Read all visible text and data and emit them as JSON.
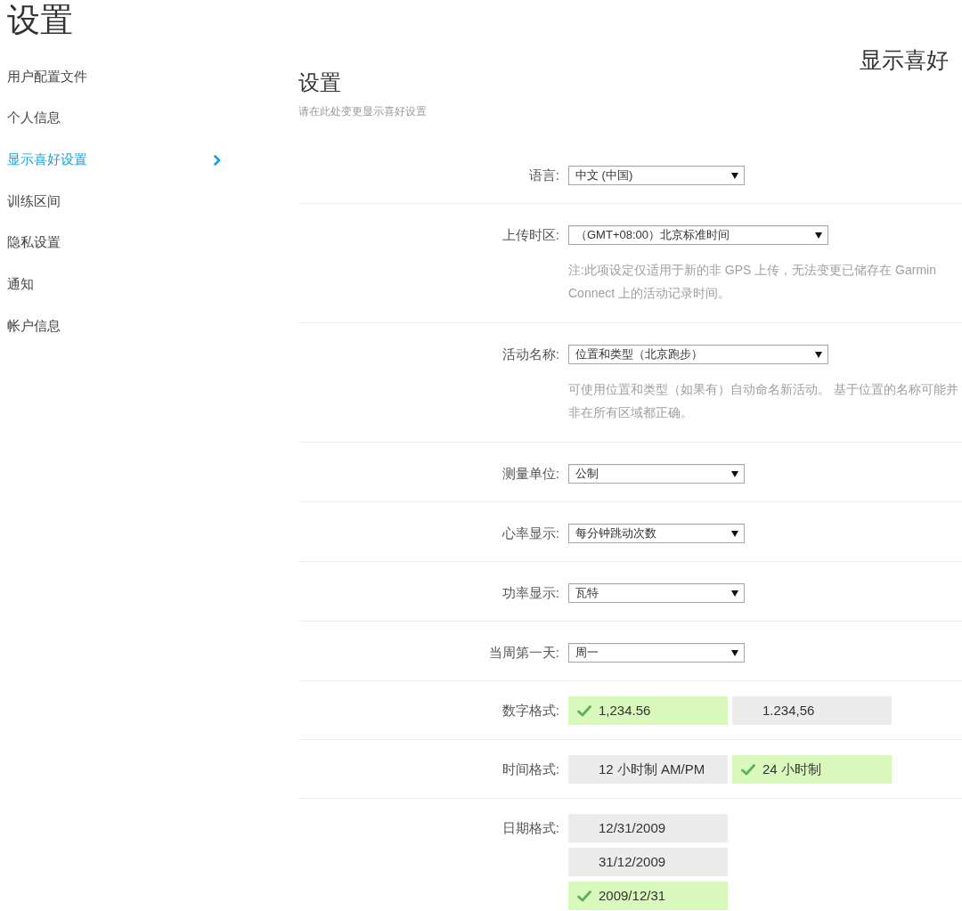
{
  "page_title": "设置",
  "sidebar": {
    "items": [
      {
        "label": "用户配置文件",
        "selected": false
      },
      {
        "label": "个人信息",
        "selected": false
      },
      {
        "label": "显示喜好设置",
        "selected": true
      },
      {
        "label": "训练区间",
        "selected": false
      },
      {
        "label": "隐私设置",
        "selected": false
      },
      {
        "label": "通知",
        "selected": false
      },
      {
        "label": "帐户信息",
        "selected": false
      }
    ]
  },
  "header": {
    "title": "显示喜好"
  },
  "section": {
    "title": "设置",
    "subtitle": "请在此处变更显示喜好设置"
  },
  "settings": [
    {
      "kind": "select",
      "label": "语言:",
      "value": "中文 (中国)"
    },
    {
      "kind": "select",
      "label": "上传时区:",
      "value": "（GMT+08:00）北京标准时间",
      "note": "注:此项设定仅适用于新的非 GPS 上传，无法变更已储存在 Garmin Connect 上的活动记录时间。"
    },
    {
      "kind": "select",
      "label": "活动名称:",
      "value": "位置和类型（北京跑步）",
      "note": "可使用位置和类型（如果有）自动命名新活动。 基于位置的名称可能并非在所有区域都正确。"
    },
    {
      "kind": "select",
      "label": "测量单位:",
      "value": "公制"
    },
    {
      "kind": "select",
      "label": "心率显示:",
      "value": "每分钟跳动次数"
    },
    {
      "kind": "select",
      "label": "功率显示:",
      "value": "瓦特"
    },
    {
      "kind": "select",
      "label": "当周第一天:",
      "value": "周一"
    },
    {
      "kind": "choice_row",
      "label": "数字格式:",
      "options": [
        {
          "label": "1,234.56",
          "selected": true
        },
        {
          "label": "1.234,56",
          "selected": false
        }
      ]
    },
    {
      "kind": "choice_row",
      "label": "时间格式:",
      "options": [
        {
          "label": "12 小时制 AM/PM",
          "selected": false
        },
        {
          "label": "24 小时制",
          "selected": true
        }
      ]
    },
    {
      "kind": "choice_column",
      "label": "日期格式:",
      "options": [
        {
          "label": "12/31/2009",
          "selected": false
        },
        {
          "label": "31/12/2009",
          "selected": false
        },
        {
          "label": "2009/12/31",
          "selected": true
        }
      ]
    }
  ]
}
